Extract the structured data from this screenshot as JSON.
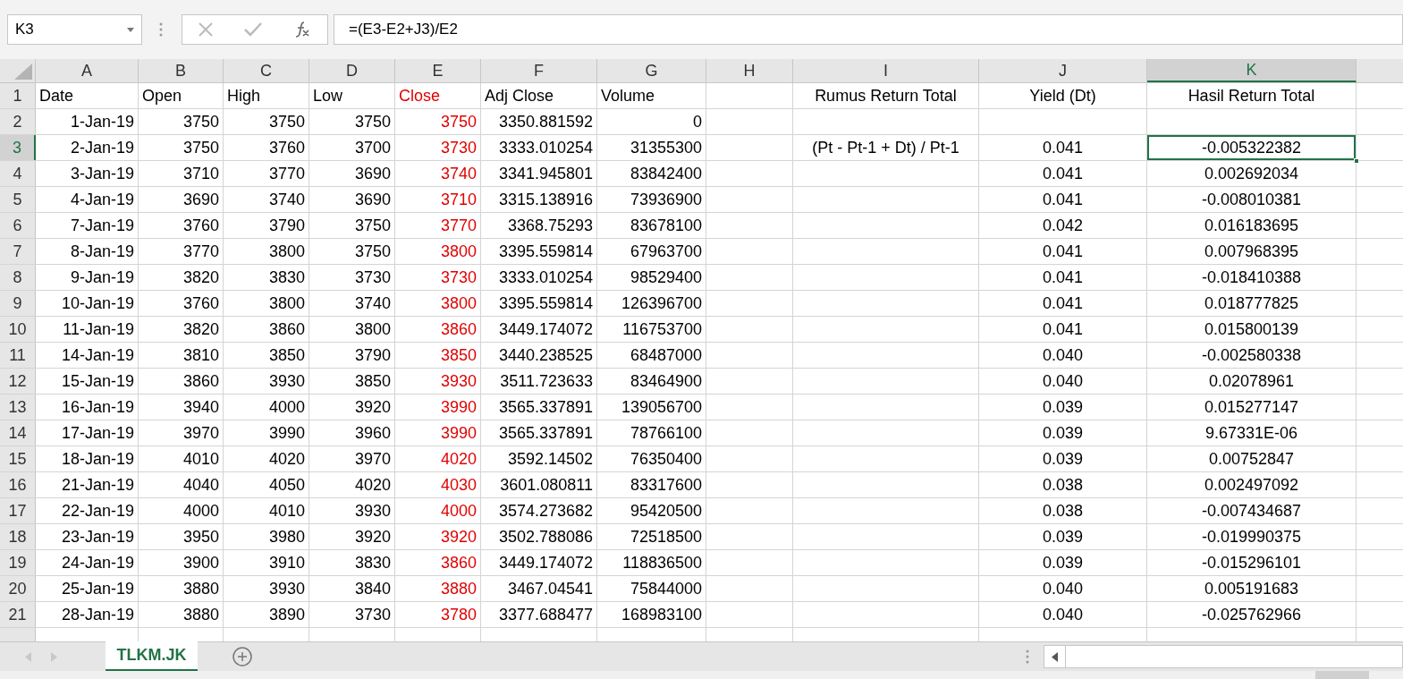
{
  "name_box": "K3",
  "formula": "=(E3-E2+J3)/E2",
  "columns": [
    {
      "letter": "A",
      "selected": false
    },
    {
      "letter": "B",
      "selected": false
    },
    {
      "letter": "C",
      "selected": false
    },
    {
      "letter": "D",
      "selected": false
    },
    {
      "letter": "E",
      "selected": false,
      "color": "#e00000"
    },
    {
      "letter": "F",
      "selected": false
    },
    {
      "letter": "G",
      "selected": false
    },
    {
      "letter": "H",
      "selected": false
    },
    {
      "letter": "I",
      "selected": false
    },
    {
      "letter": "J",
      "selected": false
    },
    {
      "letter": "K",
      "selected": true
    }
  ],
  "rows": [
    {
      "number": "1",
      "selected": false,
      "cells": {
        "A": "Date",
        "B": "Open",
        "C": "High",
        "D": "Low",
        "E": "Close",
        "F": "Adj Close",
        "G": "Volume",
        "I": "Rumus Return Total",
        "J": "Yield (Dt)",
        "K": "Hasil Return Total"
      }
    },
    {
      "number": "2",
      "selected": false,
      "cells": {
        "A": "1-Jan-19",
        "B": "3750",
        "C": "3750",
        "D": "3750",
        "E": "3750",
        "F": "3350.881592",
        "G": "0"
      }
    },
    {
      "number": "3",
      "selected": true,
      "cells": {
        "A": "2-Jan-19",
        "B": "3750",
        "C": "3760",
        "D": "3700",
        "E": "3730",
        "F": "3333.010254",
        "G": "31355300",
        "I": "(Pt - Pt-1 + Dt) / Pt-1",
        "J": "0.041",
        "K": "-0.005322382"
      }
    },
    {
      "number": "4",
      "selected": false,
      "cells": {
        "A": "3-Jan-19",
        "B": "3710",
        "C": "3770",
        "D": "3690",
        "E": "3740",
        "F": "3341.945801",
        "G": "83842400",
        "J": "0.041",
        "K": "0.002692034"
      }
    },
    {
      "number": "5",
      "selected": false,
      "cells": {
        "A": "4-Jan-19",
        "B": "3690",
        "C": "3740",
        "D": "3690",
        "E": "3710",
        "F": "3315.138916",
        "G": "73936900",
        "J": "0.041",
        "K": "-0.008010381"
      }
    },
    {
      "number": "6",
      "selected": false,
      "cells": {
        "A": "7-Jan-19",
        "B": "3760",
        "C": "3790",
        "D": "3750",
        "E": "3770",
        "F": "3368.75293",
        "G": "83678100",
        "J": "0.042",
        "K": "0.016183695"
      }
    },
    {
      "number": "7",
      "selected": false,
      "cells": {
        "A": "8-Jan-19",
        "B": "3770",
        "C": "3800",
        "D": "3750",
        "E": "3800",
        "F": "3395.559814",
        "G": "67963700",
        "J": "0.041",
        "K": "0.007968395"
      }
    },
    {
      "number": "8",
      "selected": false,
      "cells": {
        "A": "9-Jan-19",
        "B": "3820",
        "C": "3830",
        "D": "3730",
        "E": "3730",
        "F": "3333.010254",
        "G": "98529400",
        "J": "0.041",
        "K": "-0.018410388"
      }
    },
    {
      "number": "9",
      "selected": false,
      "cells": {
        "A": "10-Jan-19",
        "B": "3760",
        "C": "3800",
        "D": "3740",
        "E": "3800",
        "F": "3395.559814",
        "G": "126396700",
        "J": "0.041",
        "K": "0.018777825"
      }
    },
    {
      "number": "10",
      "selected": false,
      "cells": {
        "A": "11-Jan-19",
        "B": "3820",
        "C": "3860",
        "D": "3800",
        "E": "3860",
        "F": "3449.174072",
        "G": "116753700",
        "J": "0.041",
        "K": "0.015800139"
      }
    },
    {
      "number": "11",
      "selected": false,
      "cells": {
        "A": "14-Jan-19",
        "B": "3810",
        "C": "3850",
        "D": "3790",
        "E": "3850",
        "F": "3440.238525",
        "G": "68487000",
        "J": "0.040",
        "K": "-0.002580338"
      }
    },
    {
      "number": "12",
      "selected": false,
      "cells": {
        "A": "15-Jan-19",
        "B": "3860",
        "C": "3930",
        "D": "3850",
        "E": "3930",
        "F": "3511.723633",
        "G": "83464900",
        "J": "0.040",
        "K": "0.02078961"
      }
    },
    {
      "number": "13",
      "selected": false,
      "cells": {
        "A": "16-Jan-19",
        "B": "3940",
        "C": "4000",
        "D": "3920",
        "E": "3990",
        "F": "3565.337891",
        "G": "139056700",
        "J": "0.039",
        "K": "0.015277147"
      }
    },
    {
      "number": "14",
      "selected": false,
      "cells": {
        "A": "17-Jan-19",
        "B": "3970",
        "C": "3990",
        "D": "3960",
        "E": "3990",
        "F": "3565.337891",
        "G": "78766100",
        "J": "0.039",
        "K": "9.67331E-06"
      }
    },
    {
      "number": "15",
      "selected": false,
      "cells": {
        "A": "18-Jan-19",
        "B": "4010",
        "C": "4020",
        "D": "3970",
        "E": "4020",
        "F": "3592.14502",
        "G": "76350400",
        "J": "0.039",
        "K": "0.00752847"
      }
    },
    {
      "number": "16",
      "selected": false,
      "cells": {
        "A": "21-Jan-19",
        "B": "4040",
        "C": "4050",
        "D": "4020",
        "E": "4030",
        "F": "3601.080811",
        "G": "83317600",
        "J": "0.038",
        "K": "0.002497092"
      }
    },
    {
      "number": "17",
      "selected": false,
      "cells": {
        "A": "22-Jan-19",
        "B": "4000",
        "C": "4010",
        "D": "3930",
        "E": "4000",
        "F": "3574.273682",
        "G": "95420500",
        "J": "0.038",
        "K": "-0.007434687"
      }
    },
    {
      "number": "18",
      "selected": false,
      "cells": {
        "A": "23-Jan-19",
        "B": "3950",
        "C": "3980",
        "D": "3920",
        "E": "3920",
        "F": "3502.788086",
        "G": "72518500",
        "J": "0.039",
        "K": "-0.019990375"
      }
    },
    {
      "number": "19",
      "selected": false,
      "cells": {
        "A": "24-Jan-19",
        "B": "3900",
        "C": "3910",
        "D": "3830",
        "E": "3860",
        "F": "3449.174072",
        "G": "118836500",
        "J": "0.039",
        "K": "-0.015296101"
      }
    },
    {
      "number": "20",
      "selected": false,
      "cells": {
        "A": "25-Jan-19",
        "B": "3880",
        "C": "3930",
        "D": "3840",
        "E": "3880",
        "F": "3467.04541",
        "G": "75844000",
        "J": "0.040",
        "K": "0.005191683"
      }
    },
    {
      "number": "21",
      "selected": false,
      "cells": {
        "A": "28-Jan-19",
        "B": "3880",
        "C": "3890",
        "D": "3730",
        "E": "3780",
        "F": "3377.688477",
        "G": "168983100",
        "J": "0.040",
        "K": "-0.025762966"
      }
    }
  ],
  "sheet_tabs": [
    {
      "label": "TLKM.JK",
      "selected": true
    }
  ]
}
